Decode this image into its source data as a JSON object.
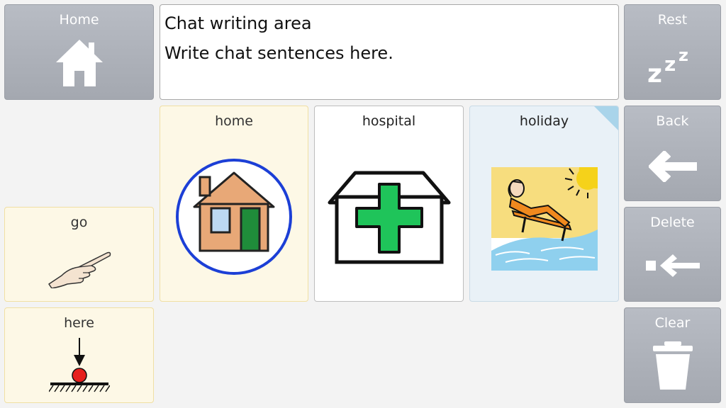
{
  "chat": {
    "line1": "Chat writing area",
    "line2": "Write chat sentences here."
  },
  "commands": {
    "home": {
      "label": "Home",
      "icon": "house-icon"
    },
    "rest": {
      "label": "Rest",
      "icon": "zzz-icon"
    },
    "back": {
      "label": "Back",
      "icon": "arrow-left-icon"
    },
    "delete": {
      "label": "Delete",
      "icon": "delete-backspace-icon"
    },
    "clear": {
      "label": "Clear",
      "icon": "trash-icon"
    }
  },
  "words": {
    "home": {
      "label": "home",
      "icon": "house-in-circle-icon"
    },
    "hospital": {
      "label": "hospital",
      "icon": "hospital-cross-icon"
    },
    "holiday": {
      "label": "holiday",
      "icon": "beach-sunbathing-icon"
    },
    "go": {
      "label": "go",
      "icon": "pointing-hand-icon"
    },
    "here": {
      "label": "here",
      "icon": "location-arrow-ball-icon"
    }
  },
  "colors": {
    "command_bg": "#a9adb5",
    "word_cream": "#fdf8e6",
    "word_blue": "#e9f1f7",
    "hospital_green": "#1fc45a",
    "circle_blue": "#1c3fd6"
  }
}
